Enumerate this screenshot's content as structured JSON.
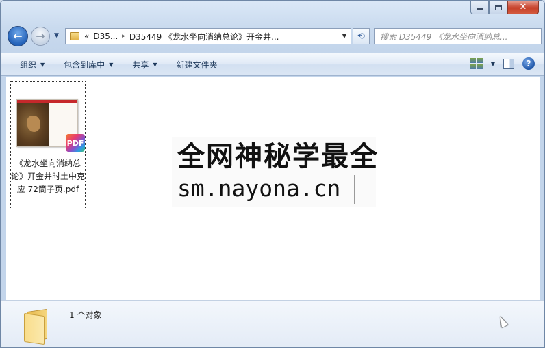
{
  "window": {
    "minimize_label": "—",
    "close_label": "✕"
  },
  "nav": {
    "back_glyph": "←",
    "forward_glyph": "→",
    "address": {
      "overflow": "«",
      "crumbs": [
        "D35...",
        "D35449 《龙水坐向消纳总论》开金井..."
      ],
      "separator": "▸"
    },
    "search_placeholder": "搜索 D35449 《龙水坐向消纳总..."
  },
  "toolbar": {
    "organize": "组织",
    "include_library": "包含到库中",
    "share": "共享",
    "new_folder": "新建文件夹",
    "help_glyph": "?"
  },
  "files": [
    {
      "name": "《龙水坐向消纳总论》开金井时土中克应 72筒子页.pdf",
      "badge": "PDF"
    }
  ],
  "watermark": {
    "line1": "全网神秘学最全",
    "line2": "sm.nayona.cn"
  },
  "status": {
    "count_text": "1 个对象"
  }
}
